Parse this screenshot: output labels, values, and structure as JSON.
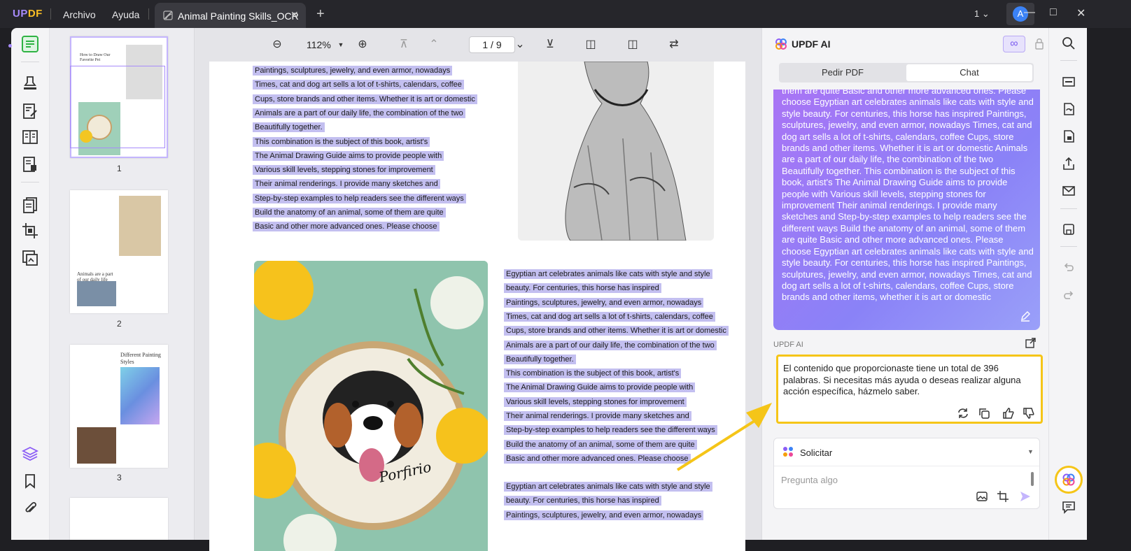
{
  "titlebar": {
    "logo_u": "UP",
    "logo_p": "DF",
    "menu_file": "Archivo",
    "menu_help": "Ayuda",
    "tab_title": "Animal Painting Skills_OCR",
    "tab_close": "✕",
    "new_tab": "+",
    "window_count": "1",
    "avatar_letter": "A"
  },
  "thumbnails": {
    "page_labels": [
      "1",
      "2",
      "3"
    ],
    "page1_title": "How to Draw Our Favorite Pet",
    "page2_heading": "Animals are a part of our daily life",
    "page3_title": "Different Painting Styles"
  },
  "viewer": {
    "zoom": "112%",
    "page_indicator": "1 / 9",
    "block1_lines": [
      "Paintings, sculptures, jewelry, and even armor, nowadays",
      "Times, cat and dog art sells a lot of t-shirts, calendars, coffee",
      "Cups, store brands and other items. Whether it is art or domestic",
      "Animals are a part of our daily life, the combination of the two",
      "Beautifully together.",
      "This combination is the subject of this book, artist's",
      "The Animal Drawing Guide aims to provide people with",
      "Various skill levels, stepping stones for improvement",
      "Their animal renderings. I provide many sketches and",
      "Step-by-step examples to help readers see the different ways",
      "Build the anatomy of an animal, some of them are quite",
      "Basic and other more advanced ones. Please choose"
    ],
    "block2_lines": [
      "Egyptian art celebrates animals like cats with style and style",
      "beauty. For centuries, this horse has inspired",
      "Paintings, sculptures, jewelry, and even armor, nowadays",
      "Times, cat and dog art sells a lot of t-shirts, calendars, coffee",
      "Cups, store brands and other items. Whether it is art or domestic",
      "Animals are a part of our daily life, the combination of the two",
      "Beautifully together.",
      "This combination is the subject of this book, artist's",
      "The Animal Drawing Guide aims to provide people with",
      "Various skill levels, stepping stones for improvement",
      "Their animal renderings. I provide many sketches and",
      "Step-by-step examples to help readers see the different ways",
      "Build the anatomy of an animal, some of them are quite",
      "Basic and other more advanced ones. Please choose"
    ],
    "block3_lines": [
      "Egyptian art celebrates animals like cats with style and style",
      "beauty. For centuries, this horse has inspired",
      "Paintings, sculptures, jewelry, and even armor, nowadays"
    ],
    "photo_caption": "Porfirio"
  },
  "ai": {
    "title": "UPDF AI",
    "tab_ask_pdf": "Pedir PDF",
    "tab_chat": "Chat",
    "user_message": "them are quite Basic and other more advanced ones. Please choose Egyptian art celebrates animals like cats with style and style beauty. For centuries, this horse has inspired Paintings, sculptures, jewelry, and even armor, nowadays Times, cat and dog art sells a lot of t-shirts, calendars, coffee Cups, store brands and other items. Whether it is art or domestic Animals are a part of our daily life, the combination of the two Beautifully together. This combination is the subject of this book, artist's The Animal Drawing Guide aims to provide people with Various skill levels, stepping stones for improvement Their animal renderings. I provide many sketches and Step-by-step examples to help readers see the different ways Build the anatomy of an animal, some of them are quite Basic and other more advanced ones. Please choose Egyptian art celebrates animals like cats with style and style beauty. For centuries, this horse has inspired Paintings, sculptures, jewelry, and even armor, nowadays Times, cat and dog art sells a lot of t-shirts, calendars, coffee Cups, store brands and other items, whether it is art or domestic",
    "answer_label": "UPDF AI",
    "answer_text": "El contenido que proporcionaste tiene un total de 396 palabras. Si necesitas más ayuda o deseas realizar alguna acción específica, házmelo saber.",
    "prompt_mode": "Solicitar",
    "input_placeholder": "Pregunta algo"
  },
  "colors": {
    "accent": "#8b5cf6",
    "highlight": "#c3bff0",
    "callout": "#f5c518"
  }
}
